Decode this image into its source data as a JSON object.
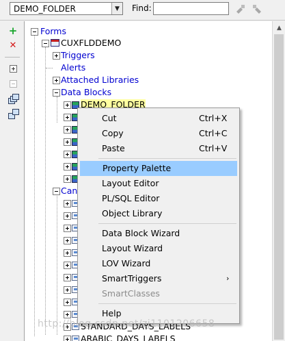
{
  "toolbar": {
    "object_combo_value": "DEMO_FOLDER",
    "find_label": "Find:",
    "find_value": "",
    "icons": [
      "flashlight-left-icon",
      "flashlight-right-icon"
    ]
  },
  "side_toolbar": {
    "icons": [
      "create-icon",
      "delete-icon",
      "expand-icon",
      "collapse-icon",
      "expand-all-icon",
      "collapse-all-icon"
    ]
  },
  "tree": {
    "root": "Forms",
    "module": "CUXFLDDEMO",
    "module_children": [
      "Triggers",
      "Alerts",
      "Attached Libraries",
      "Data Blocks"
    ],
    "selected_block": "DEMO_FOLDER",
    "canvases_label_partial": "Canv",
    "canvas_items_visible": [
      "STANDARD_DAYS_LABELS",
      "ARABIC_DAYS_LABELS"
    ]
  },
  "context_menu": {
    "groups": [
      [
        {
          "label": "Cut",
          "shortcut": "Ctrl+X"
        },
        {
          "label": "Copy",
          "shortcut": "Ctrl+C"
        },
        {
          "label": "Paste",
          "shortcut": "Ctrl+V"
        }
      ],
      [
        {
          "label": "Property Palette",
          "selected": true
        },
        {
          "label": "Layout Editor"
        },
        {
          "label": "PL/SQL Editor"
        },
        {
          "label": "Object Library"
        }
      ],
      [
        {
          "label": "Data Block Wizard"
        },
        {
          "label": "Layout Wizard"
        },
        {
          "label": "LOV Wizard"
        },
        {
          "label": "SmartTriggers",
          "submenu": true
        },
        {
          "label": "SmartClasses",
          "disabled": true
        }
      ],
      [
        {
          "label": "Help"
        }
      ]
    ]
  },
  "watermark": "http://blog.csdn.net/zj1101206658",
  "colors": {
    "tree_text": "#0000d0",
    "menu_highlight": "#99ccff",
    "selected_node_bg": "#ffffa0"
  }
}
